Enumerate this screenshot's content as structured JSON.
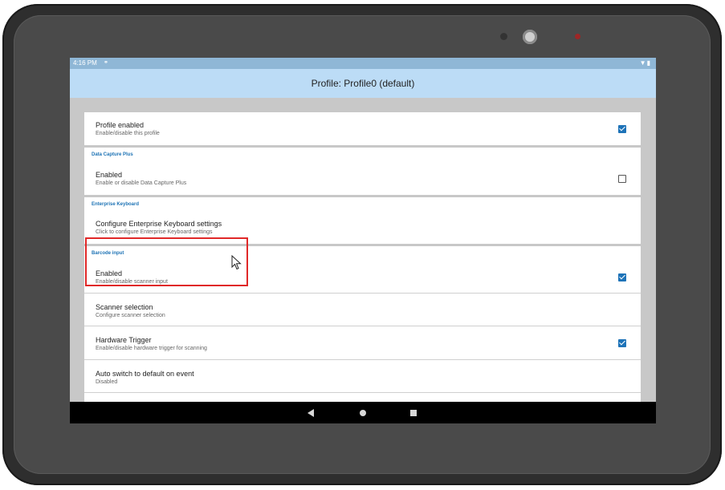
{
  "status_bar": {
    "time": "4:16 PM",
    "mic_icon": "mic-icon",
    "right_icons": "battery-wifi-icons"
  },
  "app_bar": {
    "title": "Profile: Profile0 (default)"
  },
  "settings": {
    "profile": {
      "title": "Profile enabled",
      "subtitle": "Enable/disable this profile",
      "checked": true
    },
    "data_capture_plus": {
      "header": "Data Capture Plus",
      "enabled": {
        "title": "Enabled",
        "subtitle": "Enable or disable Data Capture Plus",
        "checked": false
      }
    },
    "enterprise_keyboard": {
      "header": "Enterprise Keyboard",
      "configure": {
        "title": "Configure Enterprise Keyboard settings",
        "subtitle": "Click to configure Enterprise Keyboard settings"
      }
    },
    "barcode_input": {
      "header": "Barcode input",
      "enabled": {
        "title": "Enabled",
        "subtitle": "Enable/disable scanner input",
        "checked": true
      },
      "scanner_selection": {
        "title": "Scanner selection",
        "subtitle": "Configure scanner selection"
      },
      "hardware_trigger": {
        "title": "Hardware Trigger",
        "subtitle": "Enable/disable hardware trigger for scanning",
        "checked": true
      },
      "auto_switch": {
        "title": "Auto switch to default on event",
        "subtitle": "Disabled"
      }
    }
  },
  "nav_bar": {
    "back": "back-icon",
    "home": "home-icon",
    "recents": "recents-icon"
  },
  "colors": {
    "accent": "#1d73b5",
    "app_bar": "#bcdcf6",
    "highlight": "#e02828"
  }
}
